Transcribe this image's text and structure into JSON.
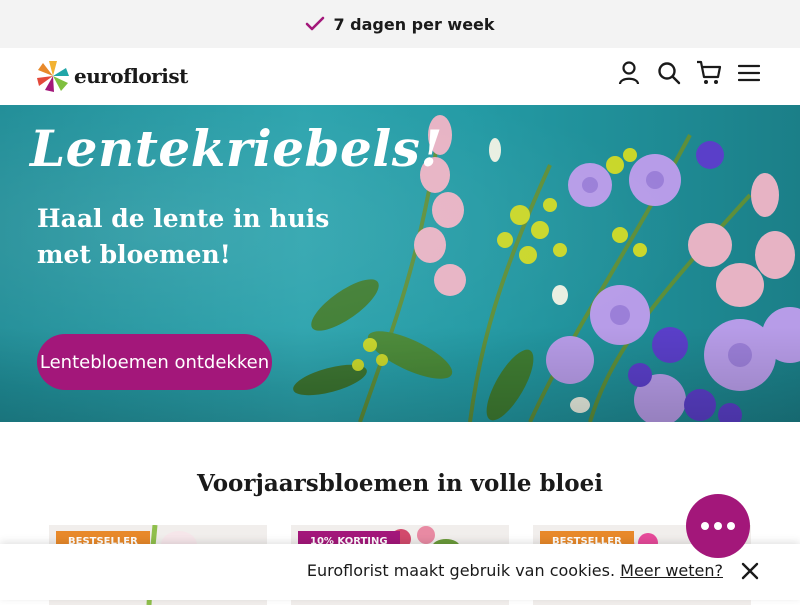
{
  "topbar": {
    "usp_text": "7 dagen per week"
  },
  "header": {
    "brand": "euroflorist"
  },
  "hero": {
    "title": "Lentekriebels!",
    "subtitle_line1": "Haal de lente in huis",
    "subtitle_line2": "met bloemen!",
    "cta_label": "Lentebloemen ontdekken"
  },
  "section": {
    "title": "Voorjaarsbloemen in volle bloei"
  },
  "products": [
    {
      "badge": "BESTSELLER"
    },
    {
      "badge": "10% KORTING"
    },
    {
      "badge": "BESTSELLER"
    }
  ],
  "cookie": {
    "message": "Euroflorist maakt gebruik van cookies.",
    "link": "Meer weten?"
  },
  "colors": {
    "accent": "#a3177a",
    "badge_orange": "#e8892a",
    "hero_teal": "#2ba3ad"
  }
}
